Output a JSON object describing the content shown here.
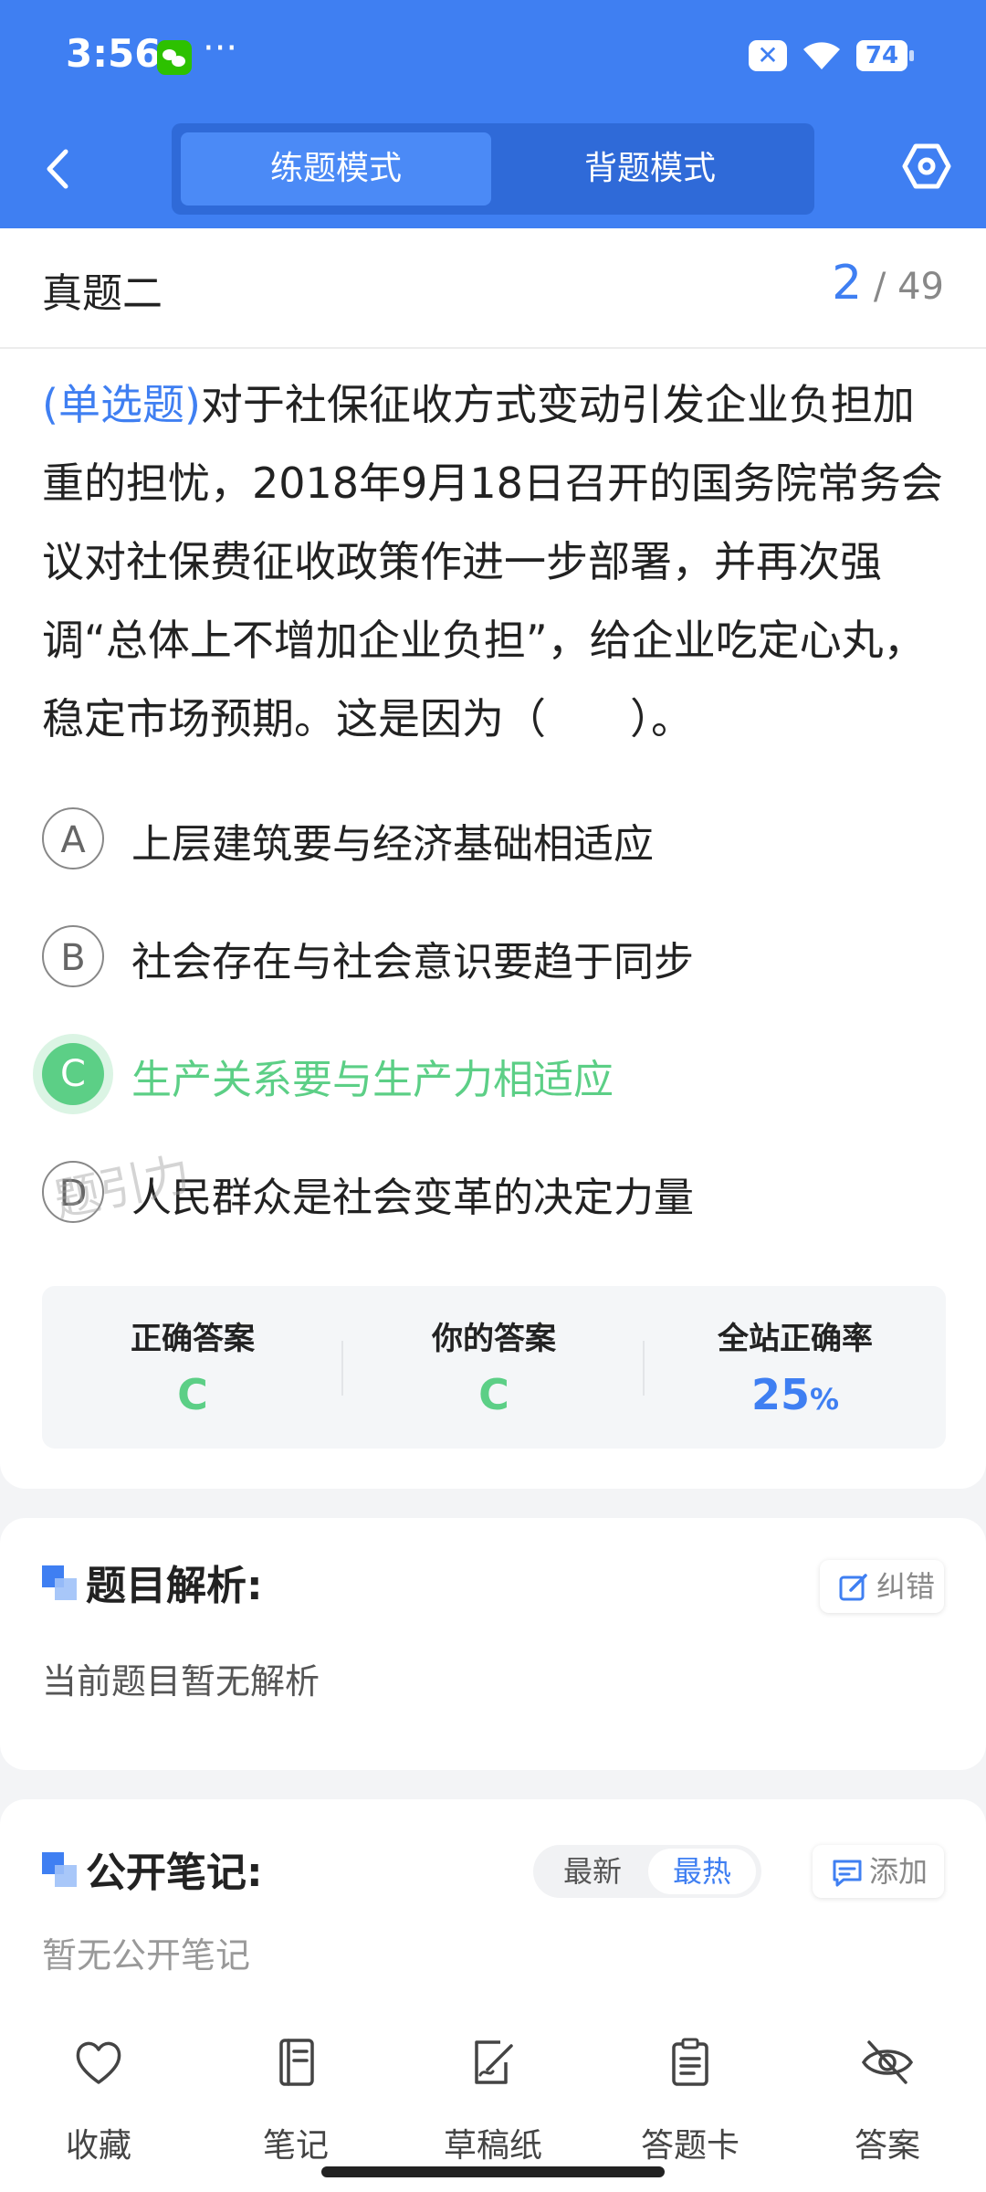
{
  "status_bar": {
    "time": "3:56",
    "battery": "74",
    "more": "···",
    "x_label": "✕"
  },
  "header": {
    "tabs": [
      {
        "label": "练题模式",
        "active": true
      },
      {
        "label": "背题模式",
        "active": false
      }
    ]
  },
  "subheader": {
    "title": "真题二",
    "current": "2",
    "total": "/ 49"
  },
  "question": {
    "type": "(单选题)",
    "text": "对于社保征收方式变动引发企业负担加重的担忧，2018年9月18日召开的国务院常务会议对社保费征收政策作进一步部署，并再次强调“总体上不增加企业负担”，给企业吃定心丸，稳定市场预期。这是因为（　　）。"
  },
  "options": [
    {
      "letter": "A",
      "text": "上层建筑要与经济基础相适应"
    },
    {
      "letter": "B",
      "text": "社会存在与社会意识要趋于同步"
    },
    {
      "letter": "C",
      "text": "生产关系要与生产力相适应",
      "correct": true
    },
    {
      "letter": "D",
      "text": "人民群众是社会变革的决定力量"
    }
  ],
  "watermark": "题引力",
  "stats": {
    "correct_label": "正确答案",
    "correct_value": "C",
    "yours_label": "你的答案",
    "yours_value": "C",
    "rate_label": "全站正确率",
    "rate_value": "25",
    "rate_unit": "%"
  },
  "analysis": {
    "title": "题目解析:",
    "report_label": "纠错",
    "text": "当前题目暂无解析"
  },
  "notes": {
    "title": "公开笔记:",
    "sort_newest": "最新",
    "sort_hot": "最热",
    "add_label": "添加",
    "empty_text": "暂无公开笔记"
  },
  "bottom_bar": [
    {
      "label": "收藏"
    },
    {
      "label": "笔记"
    },
    {
      "label": "草稿纸"
    },
    {
      "label": "答题卡"
    },
    {
      "label": "答案"
    }
  ],
  "colors": {
    "primary": "#3f7ff2",
    "correct": "#5ccf86"
  }
}
